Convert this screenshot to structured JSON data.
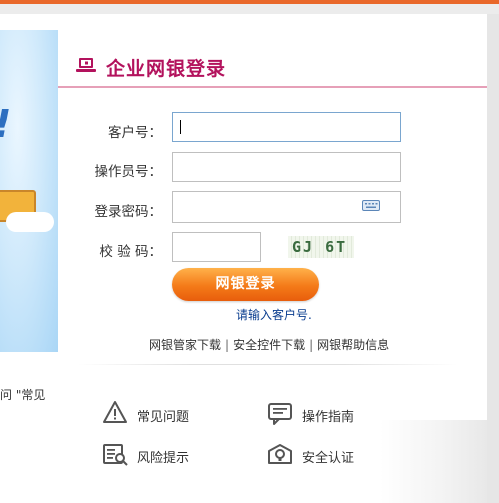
{
  "header": {
    "title": "企业网银登录",
    "accent_color": "#b3125d"
  },
  "form": {
    "customer_no": {
      "label": "客户号：",
      "value": ""
    },
    "operator_no": {
      "label": "操作员号：",
      "value": ""
    },
    "password": {
      "label": "登录密码：",
      "value": ""
    },
    "captcha": {
      "label": "校 验 码：",
      "value": "",
      "image_text": "GJ 6T"
    }
  },
  "login_button": {
    "label": "网银登录"
  },
  "hint": "请输入客户号.",
  "links": [
    "网银管家下载",
    "安全控件下载",
    "网银帮助信息"
  ],
  "help": [
    {
      "label": "常见问题",
      "icon": "warning-icon"
    },
    {
      "label": "操作指南",
      "icon": "chat-icon"
    },
    {
      "label": "风险提示",
      "icon": "book-icon"
    },
    {
      "label": "安全认证",
      "icon": "bulb-icon"
    }
  ],
  "left_footer_text": "问 \"常见"
}
